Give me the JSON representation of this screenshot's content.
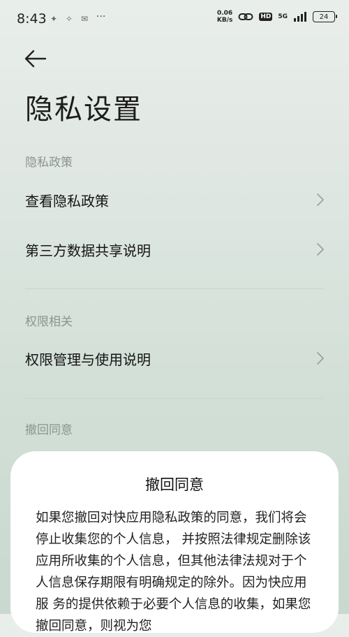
{
  "status": {
    "time": "8:43",
    "net_speed_value": "0.06",
    "net_speed_unit": "KB/s",
    "hd": "HD",
    "network": "5G",
    "battery": "24",
    "notif_icons": [
      "app-icon",
      "app-icon",
      "app-icon"
    ],
    "more": "···"
  },
  "page": {
    "title": "隐私设置"
  },
  "sections": [
    {
      "header": "隐私政策",
      "items": [
        {
          "label": "查看隐私政策"
        },
        {
          "label": "第三方数据共享说明"
        }
      ]
    },
    {
      "header": "权限相关",
      "items": [
        {
          "label": "权限管理与使用说明"
        }
      ]
    },
    {
      "header": "撤回同意",
      "items": []
    }
  ],
  "dialog": {
    "title": "撤回同意",
    "body": "如果您撤回对快应用隐私政策的同意，我们将会停止收集您的个人信息， 并按照法律规定删除该应用所收集的个人信息，但其他法律法规对于个人信息保存期限有明确规定的除外。因为快应用服 务的提供依赖于必要个人信息的收集，如果您撤回同意，则视为您"
  },
  "colors": {
    "accent_text": "#8a958f",
    "sheet_bg": "#ffffff"
  }
}
